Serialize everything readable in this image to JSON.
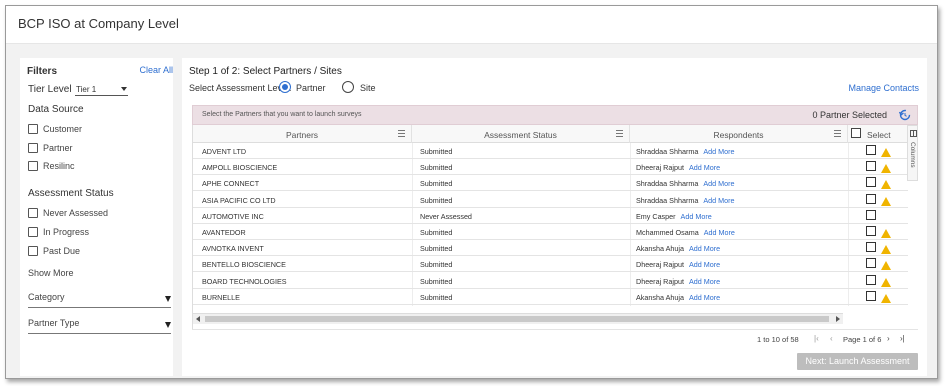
{
  "header": {
    "title": "BCP ISO at Company Level"
  },
  "filters": {
    "title": "Filters",
    "clear_all": "Clear All",
    "tier_label": "Tier Level",
    "tier_value": "Tier 1",
    "data_source_title": "Data Source",
    "data_source": [
      "Customer",
      "Partner",
      "Resilinc"
    ],
    "assessment_status_title": "Assessment Status",
    "assessment_status": [
      "Never Assessed",
      "In Progress",
      "Past Due"
    ],
    "show_more": "Show More",
    "category": "Category",
    "partner_type": "Partner Type"
  },
  "main": {
    "step_title": "Step 1 of 2: Select Partners / Sites",
    "assess_level_label": "Select Assessment Level:",
    "radio_partner": "Partner",
    "radio_site": "Site",
    "manage_contacts": "Manage Contacts",
    "info_msg": "Select the Partners that you want to launch surveys",
    "selected_count": "0 Partner Selected",
    "columns": {
      "partners": "Partners",
      "status": "Assessment Status",
      "respondents": "Respondents",
      "select": "Select"
    },
    "side_panel_label": "Columns",
    "rows": [
      {
        "partner": "ADVENT LTD",
        "status": "Submitted",
        "respondent": "Shraddaa Shharma",
        "add": "Add More",
        "warn": true
      },
      {
        "partner": "AMPOLL BIOSCIENCE",
        "status": "Submitted",
        "respondent": "Dheeraj Rajput",
        "add": "Add More",
        "warn": true
      },
      {
        "partner": "APHE CONNECT",
        "status": "Submitted",
        "respondent": "Shraddaa Shharma",
        "add": "Add More",
        "warn": true
      },
      {
        "partner": "ASIA PACIFIC CO LTD",
        "status": "Submitted",
        "respondent": "Shraddaa Shharma",
        "add": "Add More",
        "warn": true
      },
      {
        "partner": "AUTOMOTIVE INC",
        "status": "Never Assessed",
        "respondent": "Emy Casper",
        "add": "Add More",
        "warn": false
      },
      {
        "partner": "AVANTEDOR",
        "status": "Submitted",
        "respondent": "Mchammed Osama",
        "add": "Add More",
        "warn": true
      },
      {
        "partner": "AVNOTKA INVENT",
        "status": "Submitted",
        "respondent": "Akansha Ahuja",
        "add": "Add More",
        "warn": true
      },
      {
        "partner": "BENTELLO BIOSCIENCE",
        "status": "Submitted",
        "respondent": "Dheeraj Rajput",
        "add": "Add More",
        "warn": true
      },
      {
        "partner": "BOARD TECHNOLOGIES",
        "status": "Submitted",
        "respondent": "Dheeraj Rajput",
        "add": "Add More",
        "warn": true
      },
      {
        "partner": "BURNELLE",
        "status": "Submitted",
        "respondent": "Akansha Ahuja",
        "add": "Add More",
        "warn": true
      }
    ],
    "pager": {
      "range": "1 to 10 of 58",
      "page": "Page 1 of 6"
    },
    "next_button": "Next: Launch Assessment"
  },
  "colors": {
    "accent": "#2f6fd0",
    "warning": "#f0b400",
    "info_bar": "#ecdfe4",
    "disabled_button": "#bdbdbd"
  },
  "icons": {
    "refresh": "refresh-icon",
    "warning": "warning-icon",
    "column_menu": "menu-icon",
    "columns_panel": "columns-icon"
  }
}
